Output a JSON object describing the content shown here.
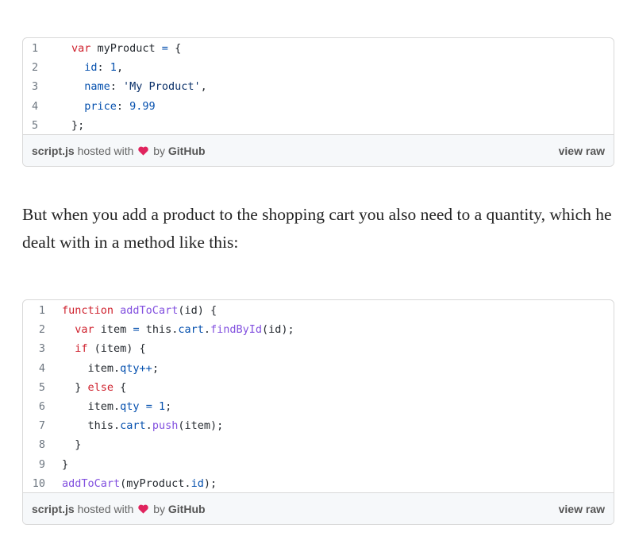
{
  "gists": [
    {
      "lines": [
        [
          {
            "t": "kw",
            "v": "var"
          },
          {
            "t": "txt",
            "v": " myProduct "
          },
          {
            "t": "op",
            "v": "="
          },
          {
            "t": "txt",
            "v": " {"
          }
        ],
        [
          {
            "t": "txt",
            "v": "  "
          },
          {
            "t": "prop",
            "v": "id"
          },
          {
            "t": "txt",
            "v": ": "
          },
          {
            "t": "num",
            "v": "1"
          },
          {
            "t": "txt",
            "v": ","
          }
        ],
        [
          {
            "t": "txt",
            "v": "  "
          },
          {
            "t": "prop",
            "v": "name"
          },
          {
            "t": "txt",
            "v": ": "
          },
          {
            "t": "str",
            "v": "'My Product'"
          },
          {
            "t": "txt",
            "v": ","
          }
        ],
        [
          {
            "t": "txt",
            "v": "  "
          },
          {
            "t": "prop",
            "v": "price"
          },
          {
            "t": "txt",
            "v": ": "
          },
          {
            "t": "num",
            "v": "9.99"
          }
        ],
        [
          {
            "t": "txt",
            "v": "};"
          }
        ]
      ],
      "footer": {
        "filename": "script.js",
        "hosted_with": "hosted with",
        "by": "by",
        "github": "GitHub",
        "view_raw": "view raw"
      }
    },
    {
      "lines": [
        [
          {
            "t": "kw",
            "v": "function"
          },
          {
            "t": "txt",
            "v": " "
          },
          {
            "t": "fn",
            "v": "addToCart"
          },
          {
            "t": "txt",
            "v": "(id) {"
          }
        ],
        [
          {
            "t": "txt",
            "v": "  "
          },
          {
            "t": "kw",
            "v": "var"
          },
          {
            "t": "txt",
            "v": " item "
          },
          {
            "t": "op",
            "v": "="
          },
          {
            "t": "txt",
            "v": " this."
          },
          {
            "t": "prop",
            "v": "cart"
          },
          {
            "t": "txt",
            "v": "."
          },
          {
            "t": "fn",
            "v": "findById"
          },
          {
            "t": "txt",
            "v": "(id);"
          }
        ],
        [
          {
            "t": "txt",
            "v": "  "
          },
          {
            "t": "kw",
            "v": "if"
          },
          {
            "t": "txt",
            "v": " (item) {"
          }
        ],
        [
          {
            "t": "txt",
            "v": "    item."
          },
          {
            "t": "prop",
            "v": "qty"
          },
          {
            "t": "op",
            "v": "++"
          },
          {
            "t": "txt",
            "v": ";"
          }
        ],
        [
          {
            "t": "txt",
            "v": "  } "
          },
          {
            "t": "kw",
            "v": "else"
          },
          {
            "t": "txt",
            "v": " {"
          }
        ],
        [
          {
            "t": "txt",
            "v": "    item."
          },
          {
            "t": "prop",
            "v": "qty"
          },
          {
            "t": "txt",
            "v": " "
          },
          {
            "t": "op",
            "v": "="
          },
          {
            "t": "txt",
            "v": " "
          },
          {
            "t": "num",
            "v": "1"
          },
          {
            "t": "txt",
            "v": ";"
          }
        ],
        [
          {
            "t": "txt",
            "v": "    this."
          },
          {
            "t": "prop",
            "v": "cart"
          },
          {
            "t": "txt",
            "v": "."
          },
          {
            "t": "fn",
            "v": "push"
          },
          {
            "t": "txt",
            "v": "(item);"
          }
        ],
        [
          {
            "t": "txt",
            "v": "  }"
          }
        ],
        [
          {
            "t": "txt",
            "v": "}"
          }
        ],
        [
          {
            "t": "fn",
            "v": "addToCart"
          },
          {
            "t": "txt",
            "v": "(myProduct."
          },
          {
            "t": "prop",
            "v": "id"
          },
          {
            "t": "txt",
            "v": ");"
          }
        ]
      ],
      "footer": {
        "filename": "script.js",
        "hosted_with": "hosted with",
        "by": "by",
        "github": "GitHub",
        "view_raw": "view raw"
      }
    }
  ],
  "paragraph": "But when you add a product to the shopping cart you also need to a quantity, which he dealt with in a method like this:",
  "colors": {
    "keyword": "#cf222e",
    "function": "#8250df",
    "property": "#0550ae",
    "string": "#0a3069",
    "heart": "#e0245e"
  },
  "icons": {
    "heart": "heart-icon"
  }
}
